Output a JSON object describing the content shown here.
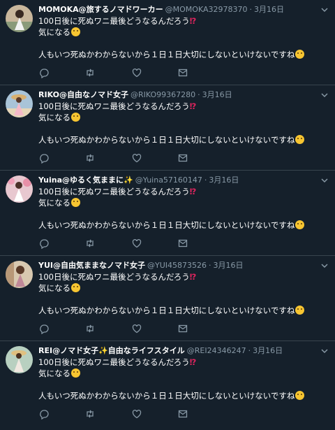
{
  "tweets": [
    {
      "name": "MOMOKA@旅するノマドワーカー",
      "handle": "@MOMOKA32978370",
      "time": "3月16日",
      "line1": "100日後に死ぬワニ最後どうなるんだろう",
      "line1_mark": "⁉",
      "line2": "気になる",
      "line3": "人もいつ死ぬかわからないから１日１日大切にしないといけないですね",
      "sparkle": ""
    },
    {
      "name": "RIKO@自由なノマド女子",
      "handle": "@RIKO99367280",
      "time": "3月16日",
      "line1": "100日後に死ぬワニ最後どうなるんだろう",
      "line1_mark": "⁉",
      "line2": "気になる",
      "line3": "人もいつ死ぬかわからないから１日１日大切にしないといけないですね",
      "sparkle": ""
    },
    {
      "name": "Yuina@ゆるく気ままに",
      "handle": "@Yuina57160147",
      "time": "3月16日",
      "line1": "100日後に死ぬワニ最後どうなるんだろう",
      "line1_mark": "⁉",
      "line2": "気になる",
      "line3": "人もいつ死ぬかわからないから１日１日大切にしないといけないですね",
      "sparkle": "✨"
    },
    {
      "name": "YUI@自由気ままなノマド女子",
      "handle": "@YUI45873526",
      "time": "3月16日",
      "line1": "100日後に死ぬワニ最後どうなるんだろう",
      "line1_mark": "⁉",
      "line2": "気になる",
      "line3": "人もいつ死ぬかわからないから１日１日大切にしないといけないですね",
      "sparkle": ""
    },
    {
      "name": "REI@ノマド女子✨自由なライフスタイル",
      "handle": "@REI24346247",
      "time": "3月16日",
      "line1": "100日後に死ぬワニ最後どうなるんだろう",
      "line1_mark": "⁉",
      "line2": "気になる",
      "line3": "人もいつ死ぬかわからないから１日１日大切にしないといけないですね",
      "sparkle": ""
    }
  ],
  "colors": {
    "background": "#15202b",
    "secondary_text": "#8899a6",
    "divider": "#38444d",
    "exclamation": "#e0245e"
  },
  "icons": [
    "reply-icon",
    "retweet-icon",
    "like-icon",
    "share-icon",
    "chevron-down-icon"
  ]
}
